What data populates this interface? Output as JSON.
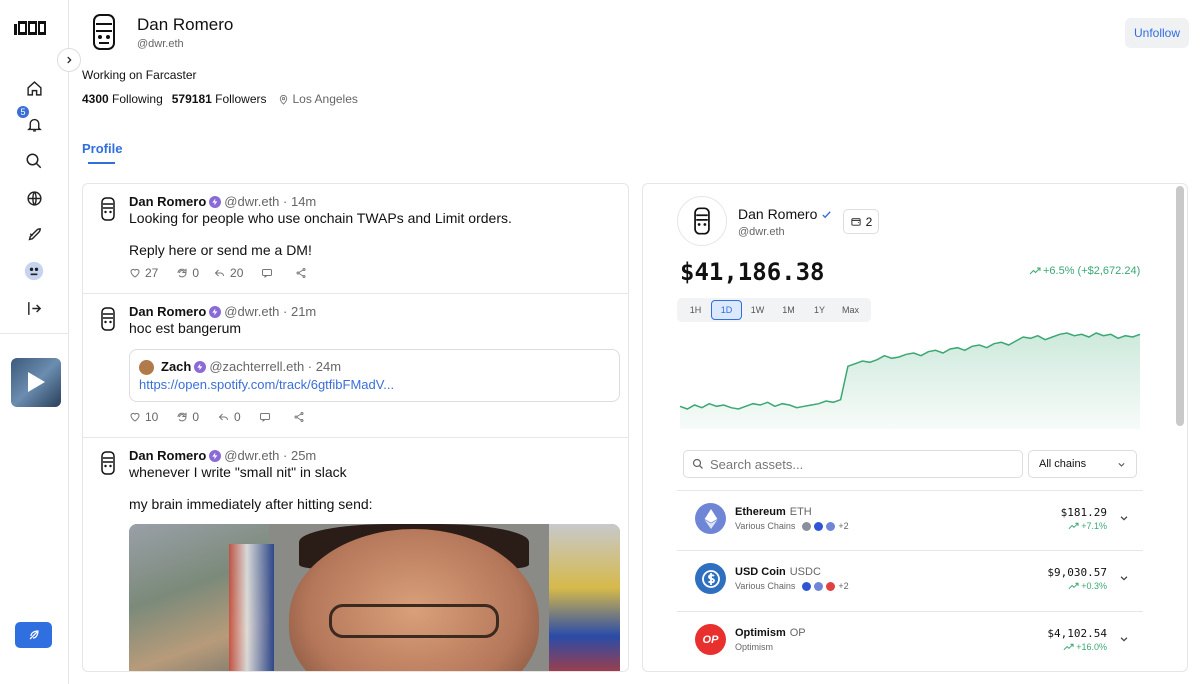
{
  "profile": {
    "name": "Dan Romero",
    "handle": "@dwr.eth",
    "bio": "Working on Farcaster",
    "following_count": "4300",
    "following_label": "Following",
    "followers_count": "579181",
    "followers_label": "Followers",
    "location": "Los Angeles",
    "unfollow_label": "Unfollow",
    "tab_label": "Profile"
  },
  "nav": {
    "notification_count": "5"
  },
  "casts": [
    {
      "name": "Dan Romero",
      "handle": "@dwr.eth · 14m",
      "line1": "Looking for people who use onchain TWAPs and Limit orders.",
      "line2": "Reply here or send me a DM!",
      "likes": "27",
      "recasts": "0",
      "replies": "20"
    },
    {
      "name": "Dan Romero",
      "handle": "@dwr.eth · 21m",
      "line1": "hoc est bangerum",
      "quote_name": "Zach",
      "quote_handle": "@zachterrell.eth · 24m",
      "quote_link": "https://open.spotify.com/track/6gtfibFMadV...",
      "likes": "10",
      "recasts": "0",
      "replies": "0"
    },
    {
      "name": "Dan Romero",
      "handle": "@dwr.eth · 25m",
      "line1": "whenever I write \"small nit\" in slack",
      "line2": "my brain immediately after hitting send:"
    }
  ],
  "wallet": {
    "name": "Dan Romero",
    "handle": "@dwr.eth",
    "wallet_count": "2",
    "total": "$41,186.38",
    "change": "+6.5% (+$2,672.24)",
    "ranges": [
      "1H",
      "1D",
      "1W",
      "1M",
      "1Y",
      "Max"
    ],
    "active_range": "1D",
    "search_placeholder": "Search assets...",
    "chain_filter": "All chains",
    "assets": [
      {
        "name": "Ethereum",
        "symbol": "ETH",
        "sub": "Various Chains",
        "extra": "+2",
        "value": "$181.29",
        "pct": "+7.1%"
      },
      {
        "name": "USD Coin",
        "symbol": "USDC",
        "sub": "Various Chains",
        "extra": "+2",
        "value": "$9,030.57",
        "pct": "+0.3%"
      },
      {
        "name": "Optimism",
        "symbol": "OP",
        "sub": "Optimism",
        "extra": "",
        "value": "$4,102.54",
        "pct": "+16.0%"
      }
    ],
    "colors": {
      "accent": "#2f6fe0",
      "positive": "#3aa873"
    }
  },
  "chart_data": {
    "type": "area",
    "series": [
      {
        "values": [
          40,
          38,
          41,
          39,
          42,
          40,
          41,
          39,
          38,
          40,
          42,
          41,
          43,
          40,
          42,
          41,
          39,
          40,
          41,
          42,
          44,
          43,
          45,
          70,
          72,
          74,
          73,
          75,
          78,
          76,
          77,
          79,
          80,
          78,
          81,
          82,
          80,
          83,
          84,
          82,
          85,
          86,
          84,
          87,
          88,
          86,
          89,
          92,
          91,
          93,
          90,
          92,
          94,
          95,
          93,
          94,
          92,
          95,
          93,
          94,
          91,
          93,
          92,
          94
        ]
      }
    ]
  }
}
